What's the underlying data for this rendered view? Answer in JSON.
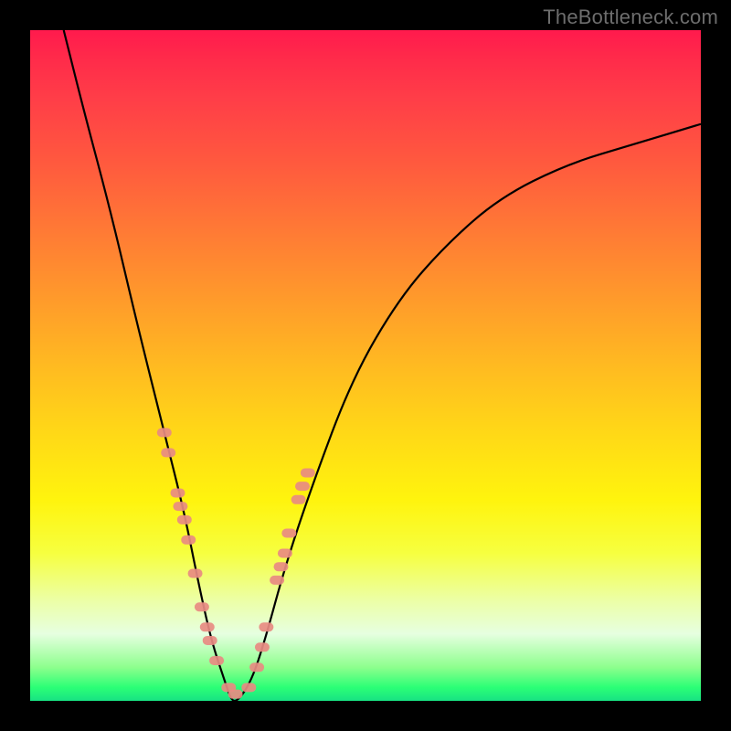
{
  "watermark": "TheBottleneck.com",
  "chart_data": {
    "type": "line",
    "title": "",
    "xlabel": "",
    "ylabel": "",
    "xlim": [
      0,
      100
    ],
    "ylim": [
      0,
      100
    ],
    "grid": false,
    "legend": false,
    "series": [
      {
        "name": "bottleneck-curve",
        "color": "#000000",
        "x": [
          5,
          8,
          12,
          16,
          20,
          23,
          25,
          27,
          29,
          30,
          31,
          33,
          35,
          38,
          42,
          48,
          55,
          62,
          70,
          80,
          90,
          100
        ],
        "y": [
          100,
          88,
          73,
          56,
          40,
          28,
          18,
          9,
          3,
          0,
          0,
          3,
          9,
          20,
          32,
          48,
          60,
          68,
          75,
          80,
          83,
          86
        ]
      }
    ],
    "marker_clusters": [
      {
        "name": "left-branch-markers",
        "shape": "pill",
        "color": "#e88b82",
        "x": [
          20.0,
          20.6,
          22.0,
          22.4,
          23.0,
          23.6,
          24.6,
          25.6,
          26.4,
          26.8,
          27.8,
          29.6,
          30.6
        ],
        "y": [
          40,
          37,
          31,
          29,
          27,
          24,
          19,
          14,
          11,
          9,
          6,
          2,
          1
        ]
      },
      {
        "name": "right-branch-markers",
        "shape": "pill",
        "color": "#e88b82",
        "x": [
          32.6,
          33.8,
          34.6,
          35.2,
          36.8,
          37.4,
          38.0,
          38.6,
          40.0,
          40.6,
          41.4
        ],
        "y": [
          2,
          5,
          8,
          11,
          18,
          20,
          22,
          25,
          30,
          32,
          34
        ]
      }
    ]
  }
}
